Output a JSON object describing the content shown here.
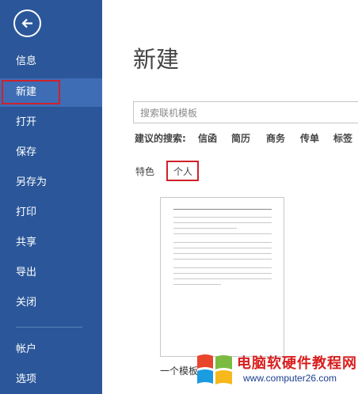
{
  "sidebar": {
    "items": [
      {
        "label": "信息"
      },
      {
        "label": "新建"
      },
      {
        "label": "打开"
      },
      {
        "label": "保存"
      },
      {
        "label": "另存为"
      },
      {
        "label": "打印"
      },
      {
        "label": "共享"
      },
      {
        "label": "导出"
      },
      {
        "label": "关闭"
      },
      {
        "label": "帐户"
      },
      {
        "label": "选项"
      }
    ],
    "active_item": "新建"
  },
  "main": {
    "title": "新建",
    "search": {
      "placeholder": "搜索联机模板"
    },
    "suggested": {
      "label": "建议的搜索:",
      "tags": [
        "信函",
        "简历",
        "商务",
        "传单",
        "标签"
      ]
    },
    "tabs": [
      {
        "label": "特色"
      },
      {
        "label": "个人"
      }
    ],
    "selected_tab": "个人",
    "template": {
      "caption": "一个模板"
    }
  },
  "watermark": {
    "text": "电脑软硬件教程网",
    "url": "www.computer26.com"
  },
  "colors": {
    "sidebar_bg": "#2b579a",
    "active_item_bg": "#3e6db5",
    "highlight_border": "#d0212b"
  }
}
